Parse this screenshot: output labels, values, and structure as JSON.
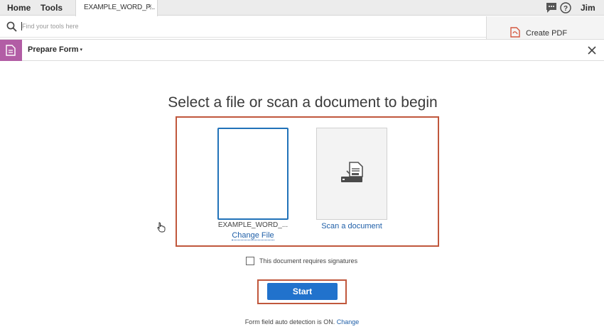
{
  "menubar": {
    "home": "Home",
    "tools": "Tools",
    "doc_tab": "EXAMPLE_WORD_F...",
    "doc_tab_close": "×",
    "user": "Jim"
  },
  "search": {
    "placeholder": "Find your tools here"
  },
  "right_panel": {
    "create_pdf": "Create PDF"
  },
  "toolbar": {
    "title": "Prepare Form",
    "caret": "▾"
  },
  "main": {
    "headline": "Select a file or scan a document to begin",
    "file_name": "EXAMPLE_WORD_...",
    "change_file": "Change File",
    "scan_label": "Scan a document",
    "signature_checkbox_label": "This document requires signatures",
    "signature_checked": false,
    "start": "Start",
    "autodetect_text": "Form field auto detection is ON.",
    "autodetect_link": "Change"
  },
  "colors": {
    "accent_blue": "#2172cc",
    "highlight_frame": "#c0573c",
    "tool_purple": "#b25da5"
  }
}
